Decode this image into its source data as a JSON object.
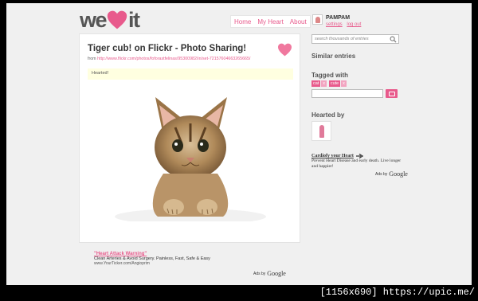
{
  "brand": {
    "logo_left": "we",
    "logo_right": "it",
    "accent": "#e85a8c"
  },
  "nav": {
    "items": [
      "Home",
      "My Heart",
      "About"
    ]
  },
  "user": {
    "name": "PAMPAM",
    "settings": "settings",
    "logout": "log out"
  },
  "entry": {
    "title": "Tiger cub! on Flickr - Photo Sharing!",
    "from_label": "from",
    "from_url": "http://www.flickr.com/photos/foforastfelinas/95300982/in/set-72157604663265665/",
    "hearted_message": "Hearted!",
    "image_icon": "kitten-photo"
  },
  "ad_bottom": {
    "title": "\"Heart Attack Warning\"",
    "desc": "Clean Arteries & Avoid Surgery. Painless, Fast, Safe & Easy",
    "url": "www.YourTicker.com/Angioprim",
    "ads_by": "Ads by",
    "google": "Google"
  },
  "sidebar": {
    "search_placeholder": "search thousands of entries",
    "similar_heading": "Similar entries",
    "tagged_heading": "Tagged with",
    "tags": [
      {
        "label": "cat",
        "remove": "x"
      },
      {
        "label": "cute",
        "remove": "x"
      }
    ],
    "hearted_by_heading": "Hearted by",
    "ad": {
      "title": "Cardiofy your Heart",
      "desc": "Prevent Heart Disease and early death. Live longer and happier!",
      "ads_by": "Ads by",
      "google": "Google"
    }
  },
  "watermark": "[1156x690] https://upic.me/"
}
